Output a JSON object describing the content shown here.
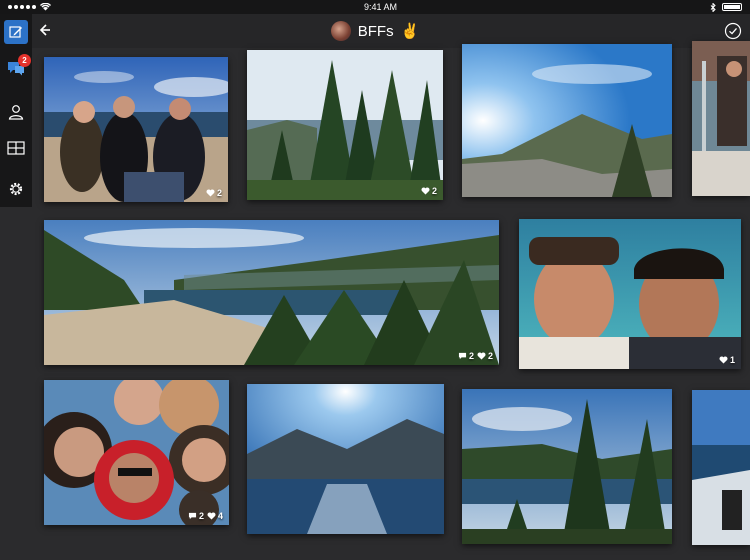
{
  "status_bar": {
    "time": "9:41 AM"
  },
  "header": {
    "album_title": "BFFs",
    "emoji": "✌️"
  },
  "sidebar": {
    "messages_badge": "2"
  },
  "photos": [
    {
      "likes": "2"
    },
    {
      "likes": "2"
    },
    {
      "likes": ""
    },
    {
      "likes": ""
    },
    {
      "comments": "2",
      "likes": "2"
    },
    {
      "likes": "1"
    },
    {
      "comments": "2",
      "likes": "4"
    },
    {
      "likes": ""
    },
    {
      "likes": ""
    },
    {
      "likes": ""
    }
  ],
  "icons": {
    "back": "chevron-left-icon",
    "done": "checkmark-circle-icon",
    "compose": "compose-icon",
    "messages": "chat-bubbles-icon",
    "contacts": "person-icon",
    "grid": "grid-icon",
    "settings": "gear-icon",
    "like": "heart-icon",
    "comment": "comment-icon"
  },
  "colors": {
    "accent": "#2c72c7",
    "badge": "#e4322c",
    "background": "#2b2b2d"
  }
}
